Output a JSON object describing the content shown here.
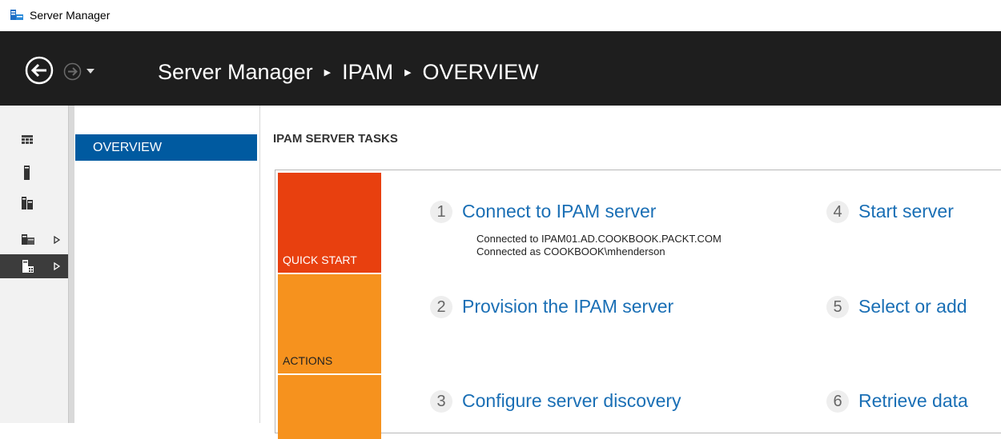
{
  "window": {
    "title": "Server Manager",
    "icon": "server-manager-icon"
  },
  "header": {
    "breadcrumb": [
      "Server Manager",
      "IPAM",
      "OVERVIEW"
    ],
    "back_icon": "back-arrow-icon",
    "forward_icon": "forward-arrow-icon"
  },
  "rail": {
    "items": [
      {
        "icon": "dashboard-icon",
        "has_arrow": false
      },
      {
        "icon": "local-server-icon",
        "has_arrow": false
      },
      {
        "icon": "all-servers-icon",
        "has_arrow": false
      },
      {
        "icon": "file-storage-icon",
        "has_arrow": true
      },
      {
        "icon": "ipam-icon",
        "has_arrow": true,
        "active": true
      }
    ]
  },
  "nav": {
    "overview_label": "OVERVIEW"
  },
  "main": {
    "section_title": "IPAM SERVER TASKS",
    "tiles": {
      "quick_start": "QUICK START",
      "actions": "ACTIONS"
    },
    "steps": [
      {
        "num": "1",
        "label": "Connect to IPAM server"
      },
      {
        "num": "2",
        "label": "Provision the IPAM server"
      },
      {
        "num": "3",
        "label": "Configure server discovery"
      },
      {
        "num": "4",
        "label": "Start server"
      },
      {
        "num": "5",
        "label": "Select or add"
      },
      {
        "num": "6",
        "label": "Retrieve data"
      }
    ],
    "connection": {
      "line1": "Connected to IPAM01.AD.COOKBOOK.PACKT.COM",
      "line2": "Connected as COOKBOOK\\mhenderson"
    }
  },
  "colors": {
    "header_bg": "#1e1e1e",
    "quick_start_tile": "#e8400f",
    "actions_tile": "#f6921e",
    "nav_selected": "#005aa0",
    "link": "#1a6fb5"
  }
}
